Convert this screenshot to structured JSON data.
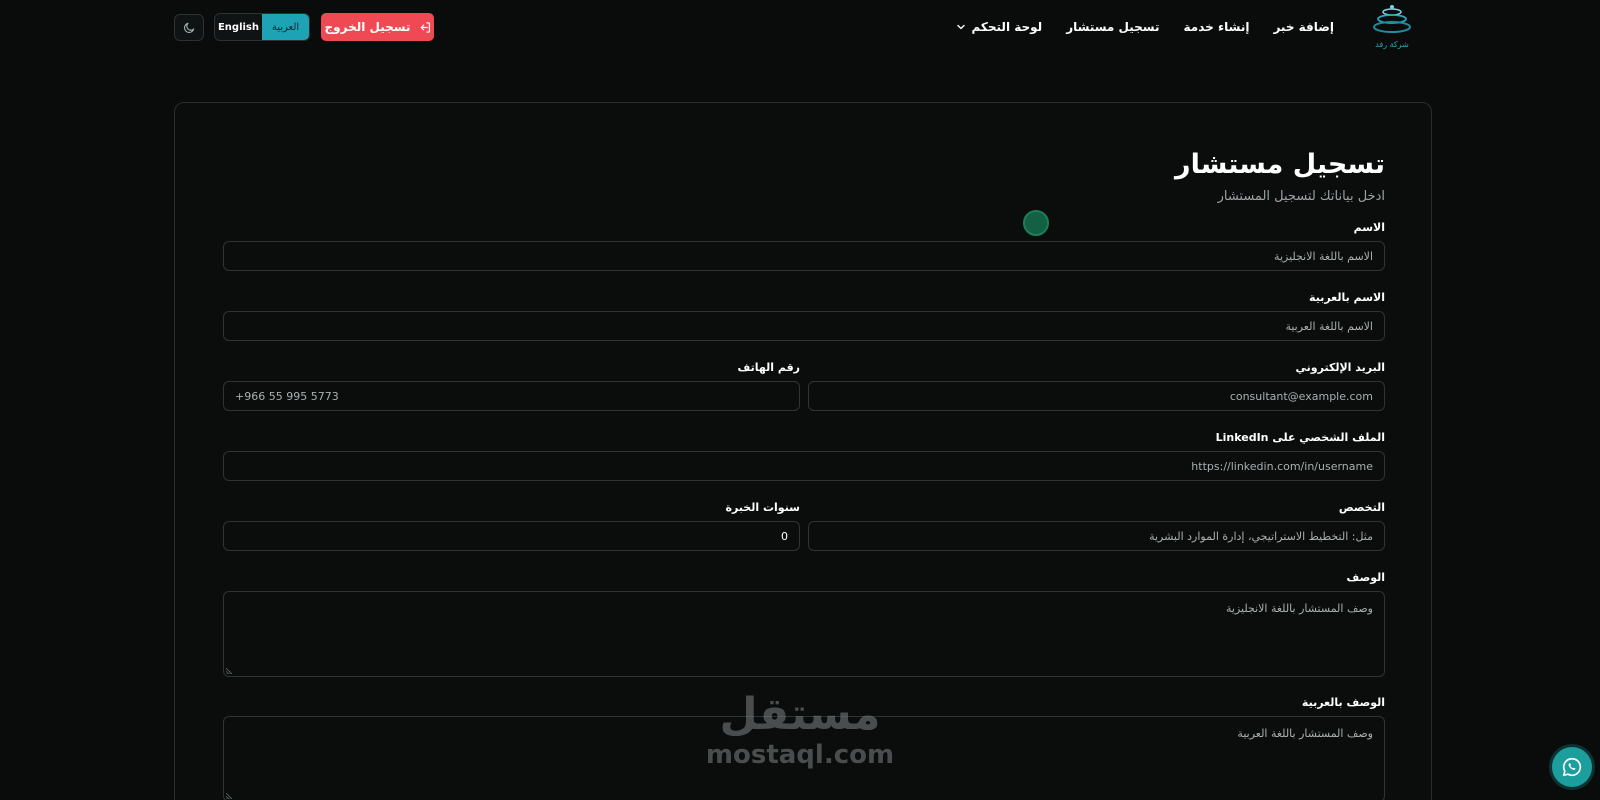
{
  "header": {
    "logo_text": "شركة رفد",
    "nav": {
      "dashboard": "لوحة التحكم",
      "register_consultant": "تسجيل مستشار",
      "create_service": "إنشاء خدمة",
      "add_news": "إضافة خبر"
    },
    "lang": {
      "english": "English",
      "arabic": "العربية",
      "active": "العربية"
    },
    "logout_label": "تسجيل الخروج",
    "icons": {
      "theme": "moon-icon",
      "logout": "logout-icon",
      "dropdown": "chevron-down-icon"
    },
    "colors": {
      "logout_bg": "#ef4a53",
      "lang_active_bg": "#1ea3b5"
    }
  },
  "form": {
    "title": "تسجيل مستشار",
    "subtitle": "ادخل بياناتك لتسجيل المستشار",
    "name": {
      "label": "الاسم",
      "placeholder": "الاسم باللغة الانجليزية"
    },
    "name_ar": {
      "label": "الاسم بالعربية",
      "placeholder": "الاسم باللغة العربية"
    },
    "email": {
      "label": "البريد الإلكتروني",
      "placeholder": "consultant@example.com"
    },
    "phone": {
      "label": "رقم الهاتف",
      "placeholder": "+966 55 995 5773"
    },
    "linkedin": {
      "label": "الملف الشخصي على LinkedIn",
      "placeholder": "https://linkedin.com/in/username"
    },
    "specialty": {
      "label": "التخصص",
      "placeholder": "مثل: التخطيط الاستراتيجي، إدارة الموارد البشرية"
    },
    "experience": {
      "label": "سنوات الخبرة",
      "value": "0"
    },
    "description": {
      "label": "الوصف",
      "placeholder": "وصف المستشار باللغة الانجليزية"
    },
    "description_ar": {
      "label": "الوصف بالعربية",
      "placeholder": "وصف المستشار باللغة العربية"
    }
  },
  "watermark": {
    "arabic": "مستقل",
    "latin": "mostaql.com"
  },
  "floating": {
    "whatsapp_icon": "whatsapp-icon",
    "color": "#1c9e9e"
  }
}
